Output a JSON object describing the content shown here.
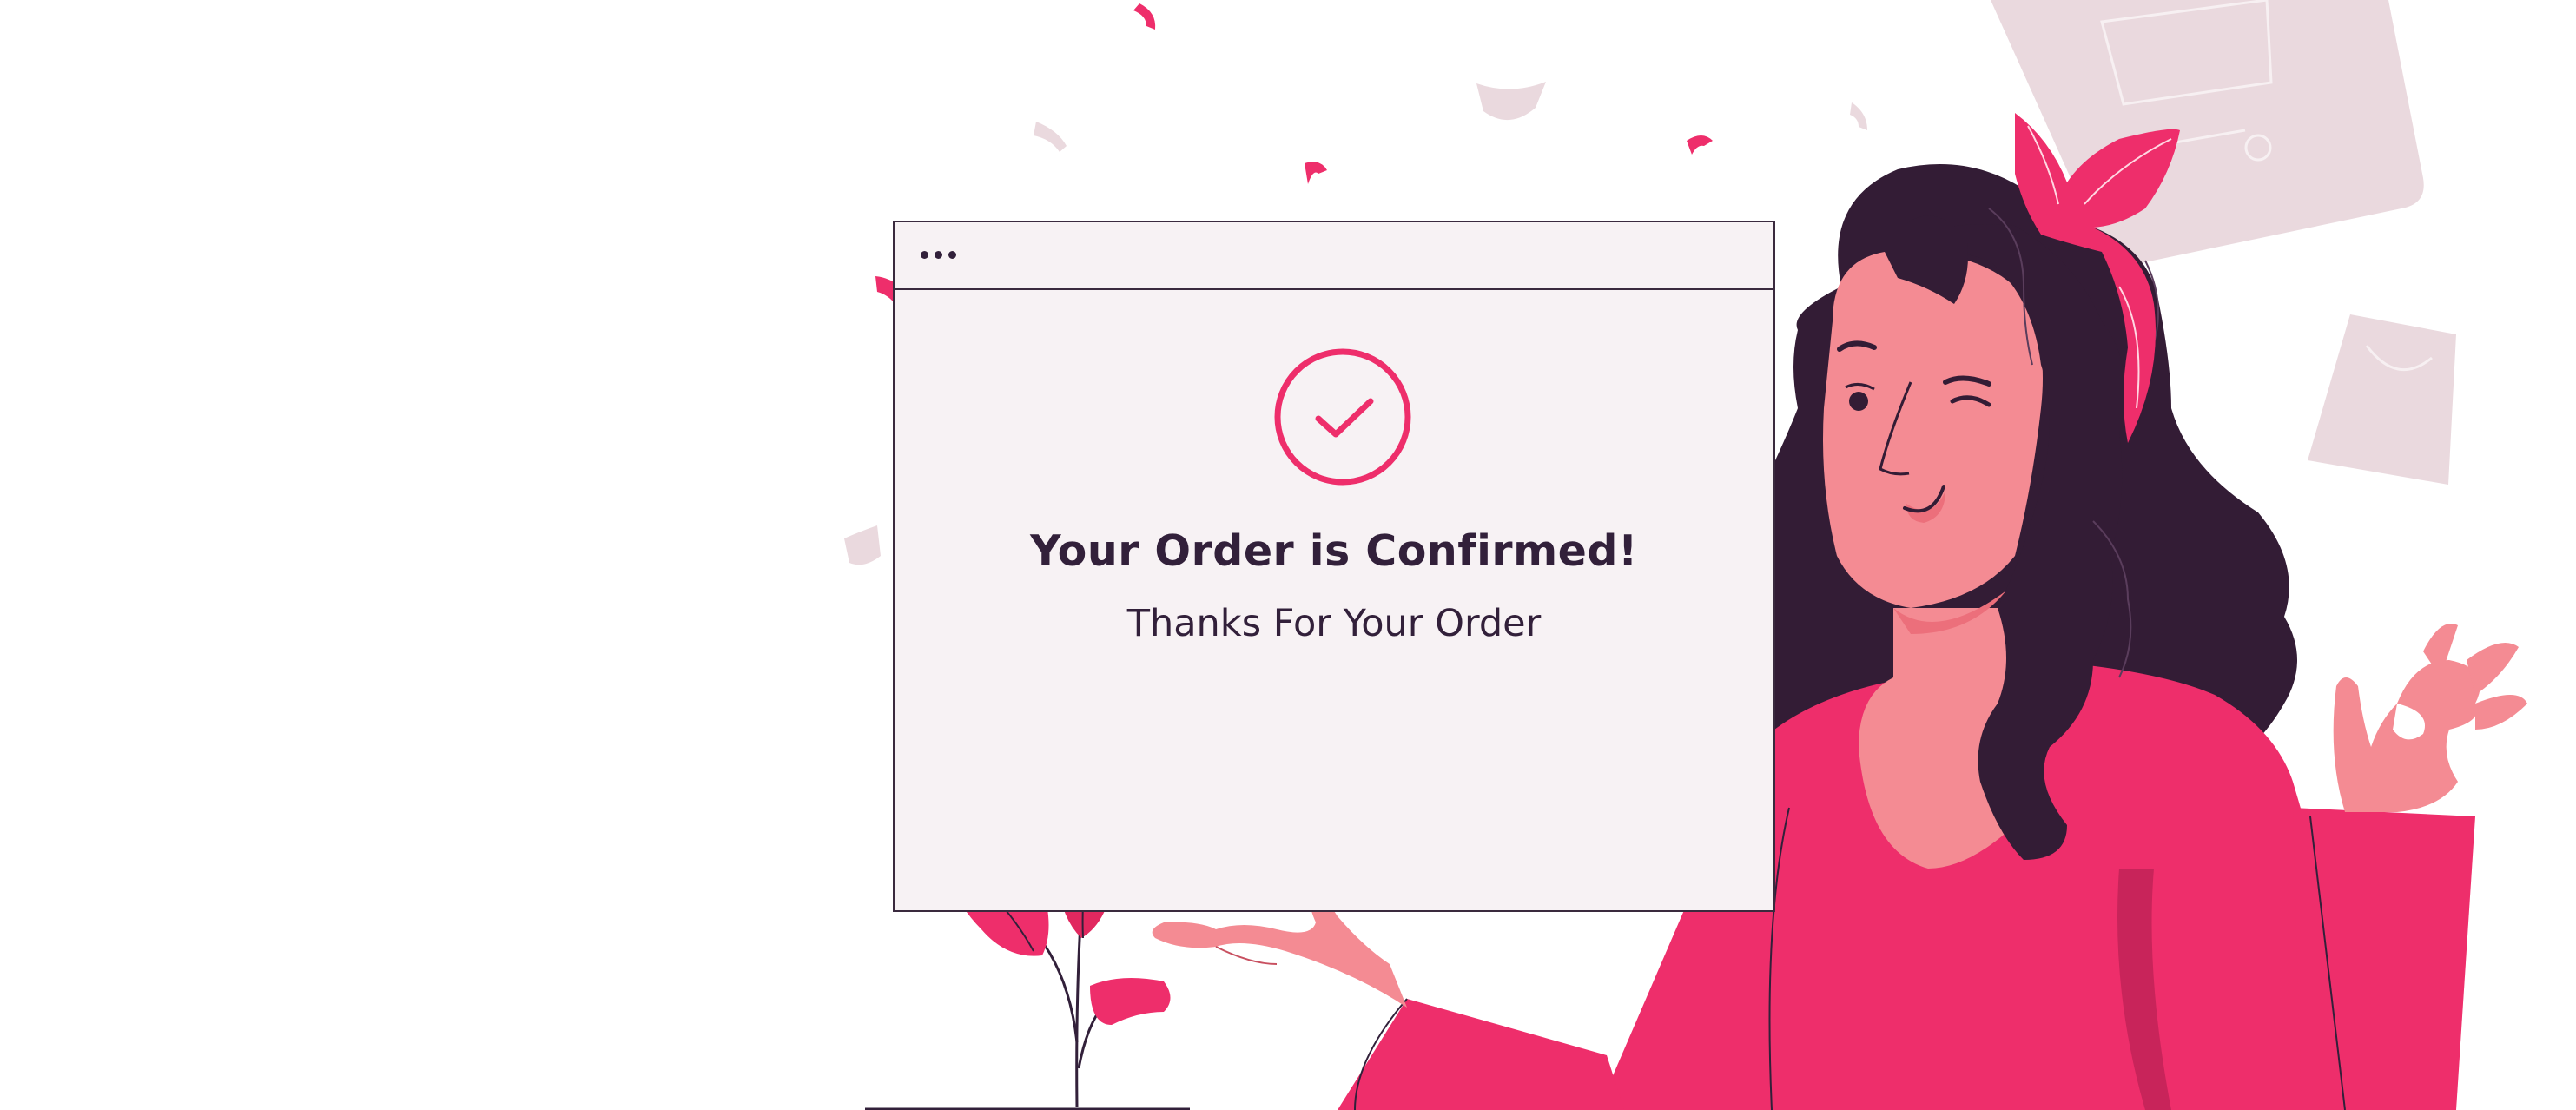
{
  "confirmation": {
    "title": "Your Order is Confirmed!",
    "subtitle": "Thanks For Your Order"
  },
  "icons": {
    "window_controls": "dots-icon",
    "status": "check-circle-icon"
  },
  "colors": {
    "background": "#ffffff",
    "window_bg": "#f7f2f4",
    "outline": "#32203a",
    "accent": "#ee2e6b",
    "accent_dark": "#c8245a",
    "skin": "#f48b93",
    "hair": "#331c35",
    "muted": "#ead9de"
  }
}
